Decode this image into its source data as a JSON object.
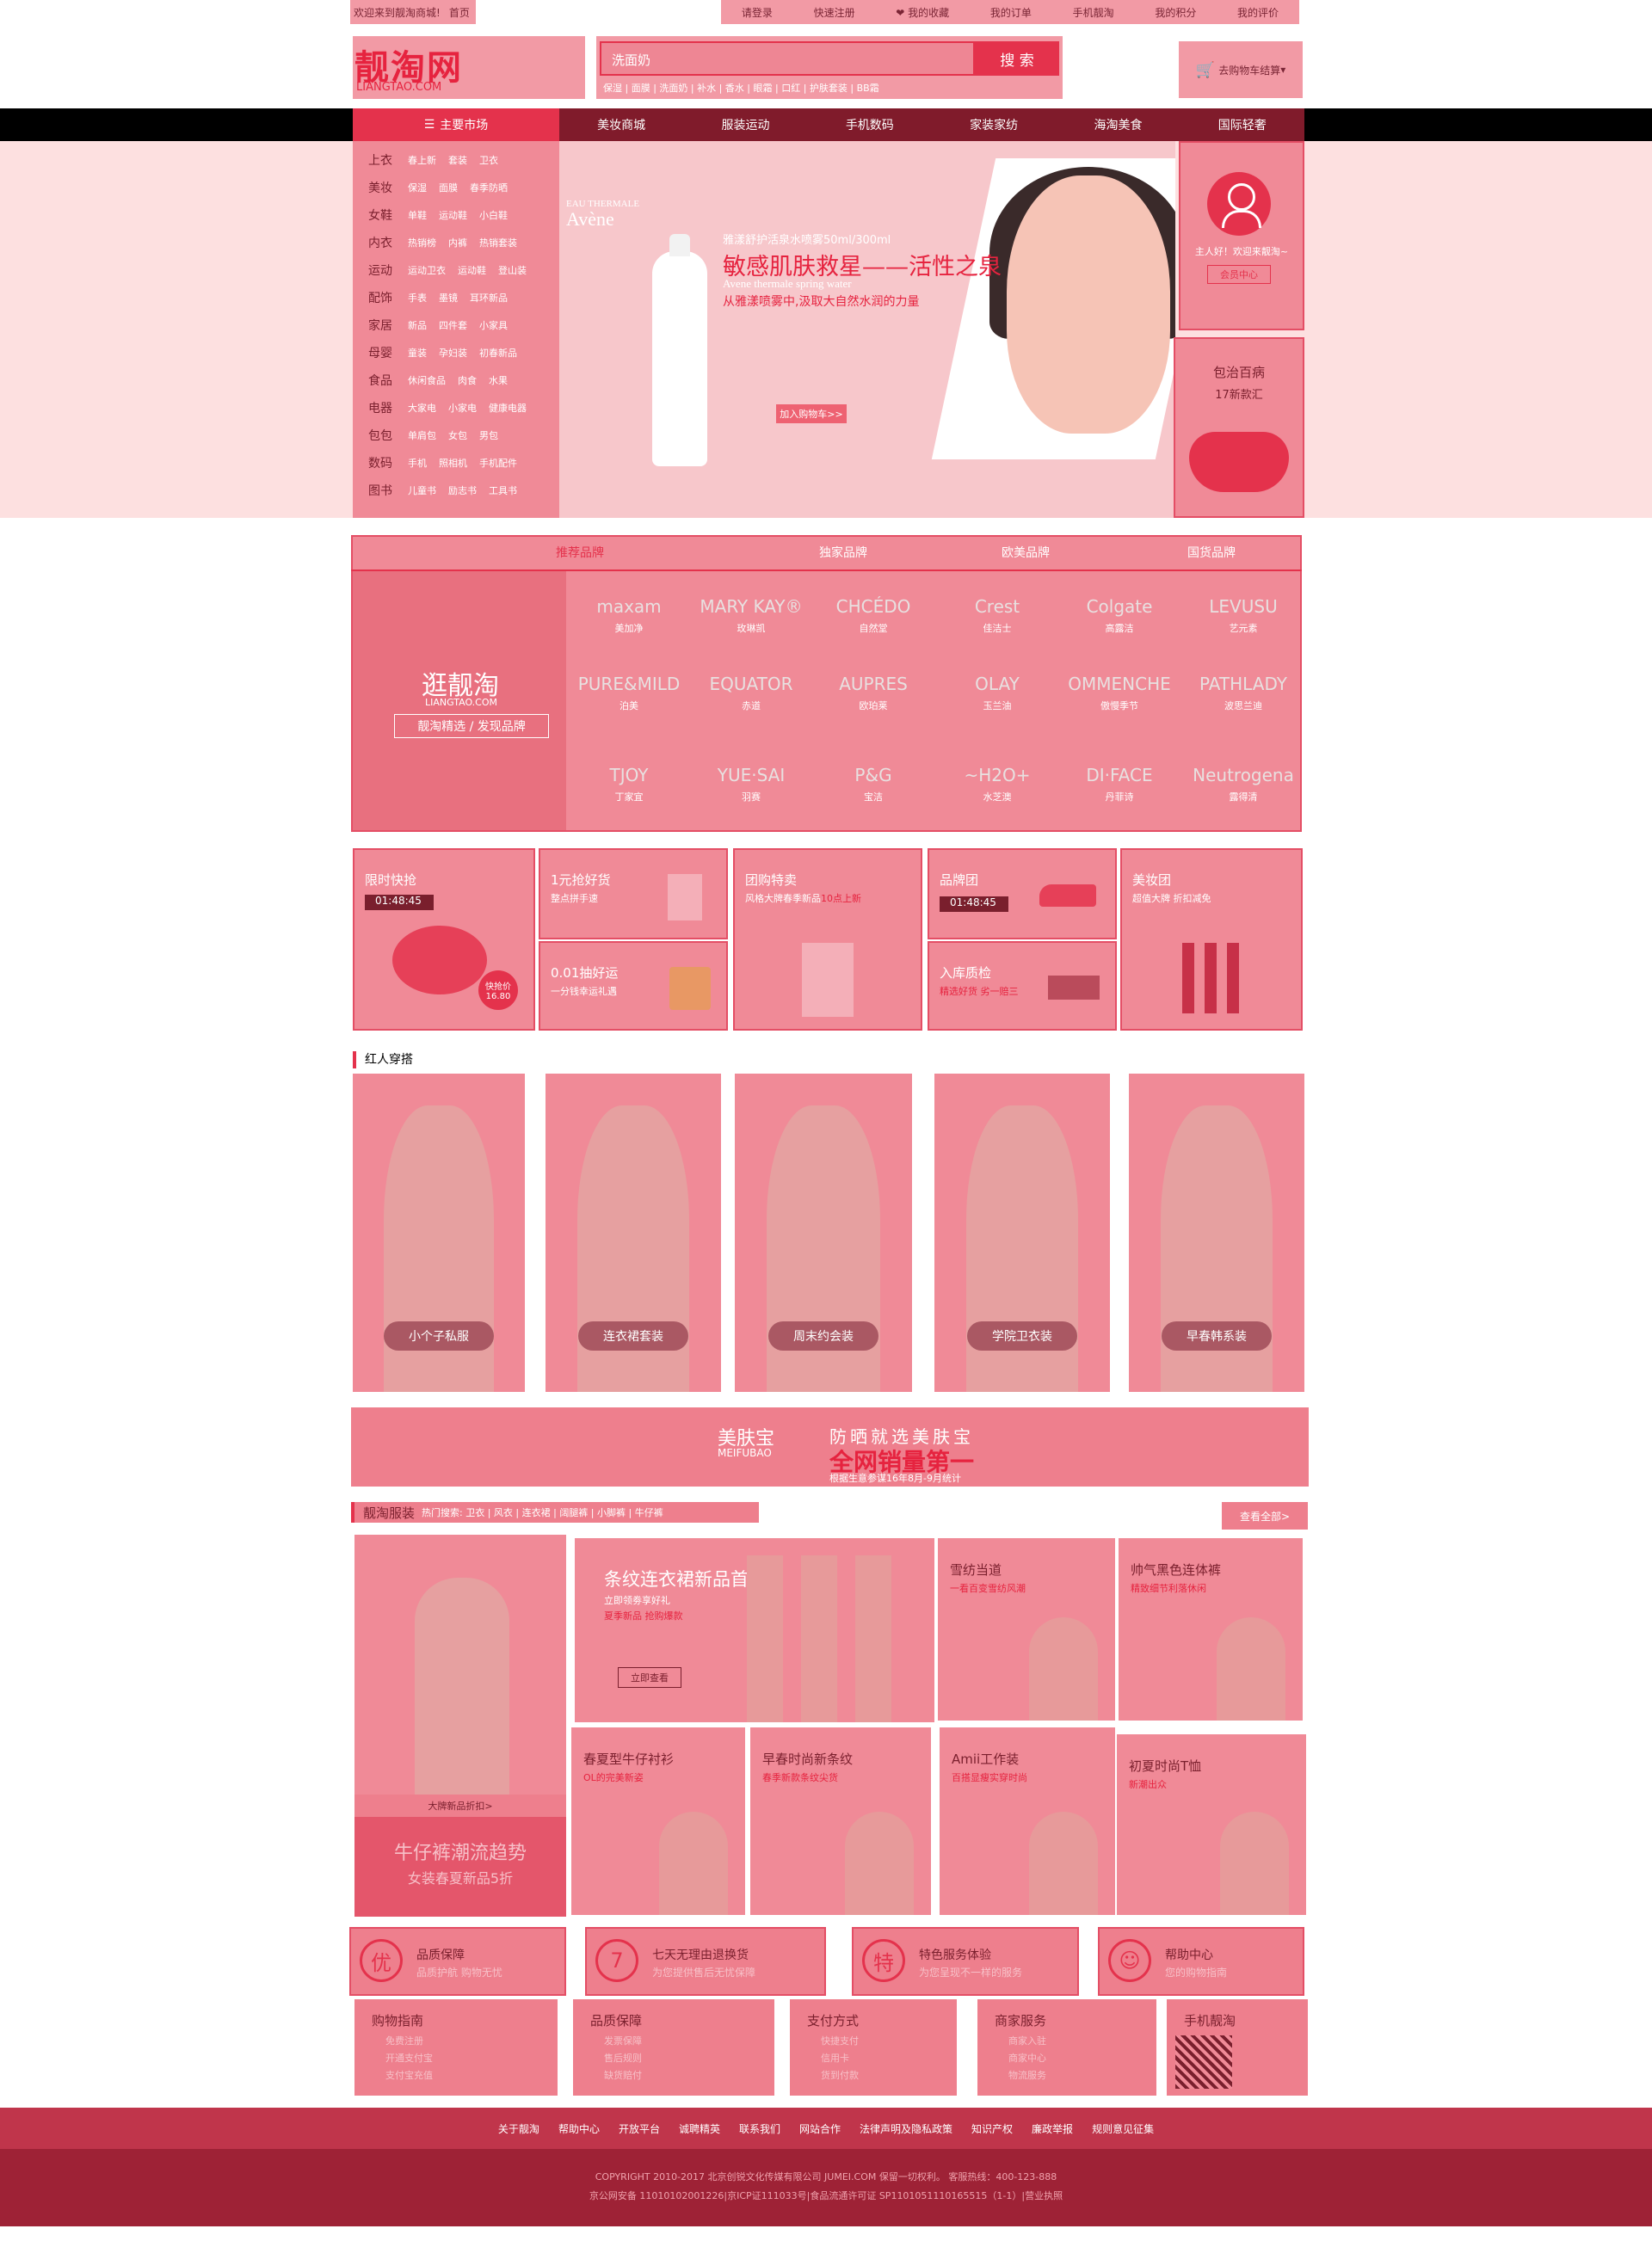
{
  "topbar": {
    "welcome": "欢迎来到靓淘商城!",
    "home": "首页",
    "links": [
      "请登录",
      "快速注册",
      "我的收藏",
      "我的订单",
      "手机靓淘",
      "我的积分",
      "我的评价"
    ]
  },
  "logo": {
    "cn": "靓淘网",
    "en": "LIANGTAO.COM"
  },
  "search": {
    "placeholder": "洗面奶",
    "button": "搜 索",
    "hot": "保湿 | 面膜 | 洗面奶 | 补水 | 香水 | 眼霜 | 口红 | 护肤套装 | BB霜"
  },
  "cart": {
    "label": "去购物车结算"
  },
  "nav": {
    "main": "主要市场",
    "links": [
      "美妆商城",
      "服装运动",
      "手机数码",
      "家装家纺",
      "海淘美食",
      "国际轻奢"
    ]
  },
  "categories": [
    {
      "h": "上衣",
      "s": [
        "春上新",
        "套装",
        "卫衣"
      ]
    },
    {
      "h": "美妆",
      "s": [
        "保湿",
        "面膜",
        "春季防晒"
      ]
    },
    {
      "h": "女鞋",
      "s": [
        "单鞋",
        "运动鞋",
        "小白鞋"
      ]
    },
    {
      "h": "内衣",
      "s": [
        "热销榜",
        "内裤",
        "热销套装"
      ]
    },
    {
      "h": "运动",
      "s": [
        "运动卫衣",
        "运动鞋",
        "登山装"
      ]
    },
    {
      "h": "配饰",
      "s": [
        "手表",
        "墨镜",
        "耳环新品"
      ]
    },
    {
      "h": "家居",
      "s": [
        "新品",
        "四件套",
        "小家具"
      ]
    },
    {
      "h": "母婴",
      "s": [
        "童装",
        "孕妇装",
        "初春新品"
      ]
    },
    {
      "h": "食品",
      "s": [
        "休闲食品",
        "肉食",
        "水果"
      ]
    },
    {
      "h": "电器",
      "s": [
        "大家电",
        "小家电",
        "健康电器"
      ]
    },
    {
      "h": "包包",
      "s": [
        "单肩包",
        "女包",
        "男包"
      ]
    },
    {
      "h": "数码",
      "s": [
        "手机",
        "照相机",
        "手机配件"
      ]
    },
    {
      "h": "图书",
      "s": [
        "儿童书",
        "励志书",
        "工具书"
      ]
    }
  ],
  "banner": {
    "brand1": "EAU THERMALE",
    "brand2": "Avène",
    "title": "雅漾舒护活泉水喷雾50ml/300ml",
    "big": "敏感肌肤救星——活性之泉",
    "en": "Avene thermale spring water",
    "cn": "从雅漾喷雾中,汲取大自然水润的力量",
    "button": "加入购物车>>"
  },
  "user": {
    "greeting": "主人好！欢迎来靓淘~",
    "button": "会员中心"
  },
  "bagad": {
    "t1": "包治百病",
    "t2": "17新款汇"
  },
  "brandtabs": [
    "推荐品牌",
    "独家品牌",
    "欧美品牌",
    "国货品牌"
  ],
  "brandpromo": {
    "t1": "逛靓淘",
    "t2": "LIANGTAO.COM",
    "t3": "靓淘精选 / 发现品牌"
  },
  "brands": [
    {
      "logo": "maxam",
      "name": "美加净"
    },
    {
      "logo": "MARY KAY®",
      "name": "玫琳凯"
    },
    {
      "logo": "CHCÉDO",
      "name": "自然堂"
    },
    {
      "logo": "Crest",
      "name": "佳洁士"
    },
    {
      "logo": "Colgate",
      "name": "高露洁"
    },
    {
      "logo": "LEVUSU",
      "name": "艺元素"
    },
    {
      "logo": "PURE&MILD",
      "name": "泊美"
    },
    {
      "logo": "EQUATOR",
      "name": "赤道"
    },
    {
      "logo": "AUPRES",
      "name": "欧珀莱"
    },
    {
      "logo": "OLAY",
      "name": "玉兰油"
    },
    {
      "logo": "OMMENCHE",
      "name": "傲慢季节"
    },
    {
      "logo": "PATHLADY",
      "name": "波思兰迪"
    },
    {
      "logo": "TJOY",
      "name": "丁家宜"
    },
    {
      "logo": "YUE·SAI",
      "name": "羽赛"
    },
    {
      "logo": "P&G",
      "name": "宝洁"
    },
    {
      "logo": "~H2O+",
      "name": "水芝澳"
    },
    {
      "logo": "DI·FACE",
      "name": "丹菲诗"
    },
    {
      "logo": "Neutrogena",
      "name": "露得清"
    }
  ],
  "deals": {
    "d1": {
      "t": "限时快抢",
      "tm": "01:48:45",
      "price1": "快抢价",
      "price2": "16.80"
    },
    "d2": {
      "t": "1元抢好货",
      "s": "整点拼手速"
    },
    "d3": {
      "t": "0.01抽好运",
      "s": "一分钱幸运礼遇"
    },
    "d4": {
      "t": "团购特卖",
      "s1": "风格大牌春季新品",
      "s2": "10点上新"
    },
    "d5": {
      "t": "品牌团",
      "tm": "01:48:45"
    },
    "d6": {
      "t": "入库质检",
      "s1": "精选好货",
      "s2": "劣一赔三"
    },
    "d7": {
      "t": "美妆团",
      "s": "超值大牌 折扣减免"
    }
  },
  "redstyle": {
    "title": "红人穿搭",
    "looks": [
      "小个子私服",
      "连衣裙套装",
      "周末约会装",
      "学院卫衣装",
      "早春韩系装"
    ]
  },
  "strip": {
    "a": "美肤宝",
    "b": "MEIFUBAO",
    "c1": "防晒就选美肤宝",
    "c2": "全网销量第一",
    "c3": "根据生意参谋16年8月-9月统计"
  },
  "clothing": {
    "title": "靓淘服装",
    "hot": "热门搜索: 卫衣 | 风衣 | 连衣裙 | 阔腿裤 | 小脚裤 | 牛仔裤",
    "more": "查看全部>",
    "left": {
      "t1": "大牌新品折扣>",
      "t2": "牛仔裤潮流趋势",
      "t3": "女装春夏新品5折"
    },
    "feature": {
      "t": "条纹连衣裙新品首发",
      "s1": "立即领劵享好礼",
      "s2": "夏季新品 抢购爆款",
      "btn": "立即查看"
    },
    "items": [
      {
        "t": "雪纺当道",
        "s": "一看百变雪纺风潮"
      },
      {
        "t": "帅气黑色连体裤",
        "s": "精致细节利落休闲"
      },
      {
        "t": "春夏型牛仔衬衫",
        "s": "OL的完美新姿"
      },
      {
        "t": "早春时尚新条纹",
        "s": "春季新款条纹尖货"
      },
      {
        "t": "Amii工作装",
        "s": "百搭显瘦实穿时尚"
      },
      {
        "t": "初夏时尚T恤",
        "s": "新潮出众"
      }
    ]
  },
  "services": [
    {
      "ic": "优",
      "t": "品质保障",
      "s": "品质护航  购物无忧"
    },
    {
      "ic": "7",
      "t": "七天无理由退换货",
      "s": "为您提供售后无忧保障"
    },
    {
      "ic": "特",
      "t": "特色服务体验",
      "s": "为您呈现不一样的服务"
    },
    {
      "ic": "☺",
      "t": "帮助中心",
      "s": "您的购物指南"
    }
  ],
  "links": [
    {
      "h": "购物指南",
      "i": [
        "免费注册",
        "开通支付宝",
        "支付宝充值"
      ]
    },
    {
      "h": "品质保障",
      "i": [
        "发票保障",
        "售后规则",
        "缺货赔付"
      ]
    },
    {
      "h": "支付方式",
      "i": [
        "快捷支付",
        "信用卡",
        "货到付款"
      ]
    },
    {
      "h": "商家服务",
      "i": [
        "商家入驻",
        "商家中心",
        "物流服务"
      ]
    },
    {
      "h": "手机靓淘",
      "i": []
    }
  ],
  "footer": {
    "links": [
      "关于靓淘",
      "帮助中心",
      "开放平台",
      "诚聘精英",
      "联系我们",
      "网站合作",
      "法律声明及隐私政策",
      "知识产权",
      "廉政举报",
      "规则意见征集"
    ],
    "copy": "COPYRIGHT 2010-2017 北京创锐文化传媒有限公司 JUMEI.COM 保留一切权利。 客服热线：400-123-888",
    "icp": "京公网安备 11010102001226|京ICP证111033号|食品流通许可证 SP1101051110165515（1-1）|营业执照"
  }
}
